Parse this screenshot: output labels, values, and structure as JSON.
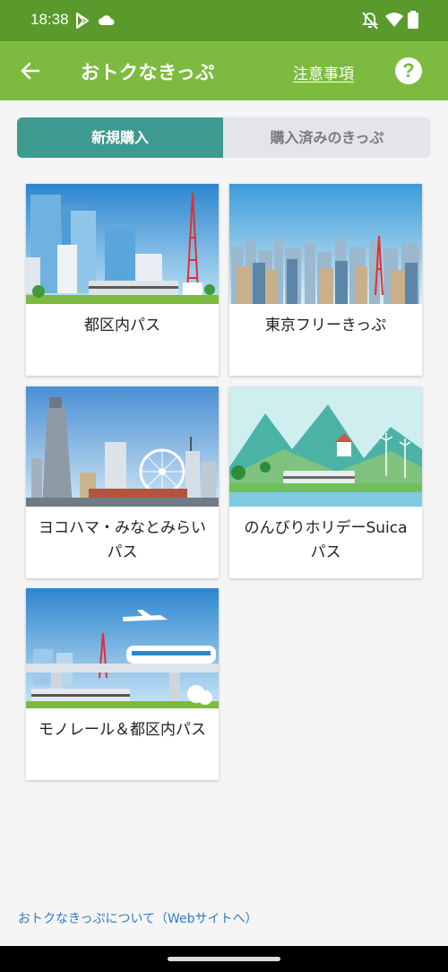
{
  "status_bar": {
    "time": "18:38"
  },
  "app_bar": {
    "title": "おトクなきっぷ",
    "notes_link": "注意事項",
    "help_icon": "?"
  },
  "tabs": [
    {
      "label": "新規購入",
      "active": true
    },
    {
      "label": "購入済みのきっぷ",
      "active": false
    }
  ],
  "tickets": [
    {
      "label": "都区内パス"
    },
    {
      "label": "東京フリーきっぷ"
    },
    {
      "label": "ヨコハマ・みなとみらいパス"
    },
    {
      "label": "のんびりホリデーSuicaパス"
    },
    {
      "label": "モノレール＆都区内パス"
    }
  ],
  "footer": {
    "link": "おトクなきっぷについて（Webサイトへ）"
  },
  "colors": {
    "status_bar": "#5a9a2c",
    "app_bar": "#7cbb3f",
    "tab_active": "#3d9a8e",
    "link": "#2f7bc4"
  }
}
